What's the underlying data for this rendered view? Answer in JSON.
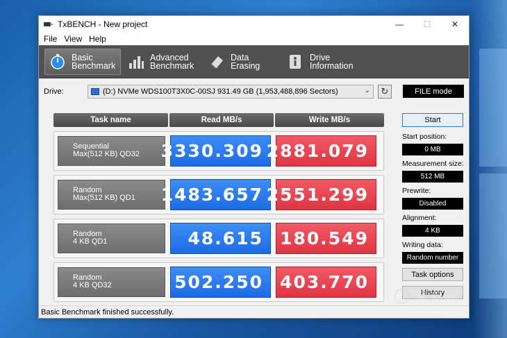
{
  "window": {
    "title": "TxBENCH - New project",
    "controls": {
      "minimize": "—",
      "maximize": "☐",
      "close": "✕"
    }
  },
  "menu": [
    "File",
    "View",
    "Help"
  ],
  "toolbar": {
    "tabs": [
      {
        "label": "Basic\nBenchmark",
        "icon": "stopwatch-icon",
        "active": true
      },
      {
        "label": "Advanced\nBenchmark",
        "icon": "bar-chart-icon",
        "active": false
      },
      {
        "label": "Data Erasing",
        "icon": "eraser-icon",
        "active": false
      },
      {
        "label": "Drive\nInformation",
        "icon": "info-icon",
        "active": false
      }
    ]
  },
  "drive": {
    "label": "Drive:",
    "selected": "(D:) NVMe WDS100T3X0C-00SJ  931.49 GB (1,953,488,896 Sectors)",
    "mode": "FILE mode"
  },
  "table": {
    "headers": {
      "task": "Task name",
      "read": "Read MB/s",
      "write": "Write MB/s"
    },
    "rows": [
      {
        "task": "Sequential\nMax(512 KB) QD32",
        "read": "3330.309",
        "write": "2881.079"
      },
      {
        "task": "Random\nMax(512 KB) QD1",
        "read": "1483.657",
        "write": "2551.299"
      },
      {
        "task": "Random\n4 KB QD1",
        "read": "48.615",
        "write": "180.549"
      },
      {
        "task": "Random\n4 KB QD32",
        "read": "502.250",
        "write": "403.770"
      }
    ]
  },
  "settings": {
    "start_button": "Start",
    "start_position_label": "Start position:",
    "start_position": "0 MB",
    "measurement_size_label": "Measurement size:",
    "measurement_size": "512 MB",
    "prewrite_label": "Prewrite:",
    "prewrite": "Disabled",
    "alignment_label": "Alignment:",
    "alignment": "4 KB",
    "writing_data_label": "Writing data:",
    "writing_data": "Random number",
    "task_options_button": "Task options",
    "history_button": "History"
  },
  "status": "Basic Benchmark finished successfully.",
  "watermark": "泡泡网",
  "colors": {
    "read": "#2b7cf0",
    "write": "#e84350",
    "toolbar": "#505050",
    "accent": "#2b7ad6"
  }
}
